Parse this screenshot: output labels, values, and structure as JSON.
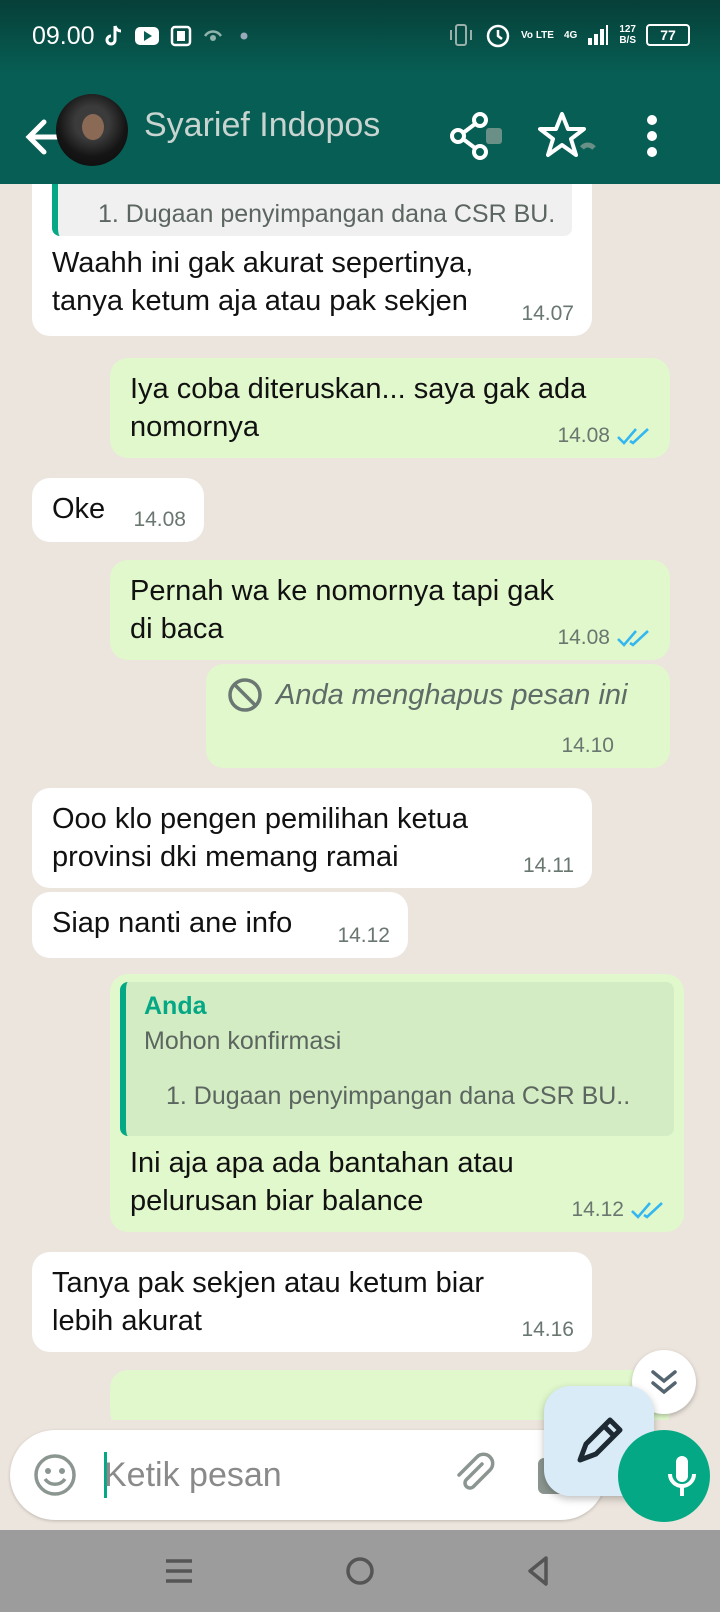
{
  "status_bar": {
    "time": "09.00",
    "net_type": "Vo LTE",
    "net_gen": "4G",
    "net_speed": "127",
    "net_speed_unit": "B/S",
    "battery": "77"
  },
  "header": {
    "contact_name": "Syarief Indopos"
  },
  "messages": [
    {
      "dir": "in",
      "quote_line": "1. Dugaan penyimpangan dana CSR BU..",
      "text": "Waahh ini gak akurat sepertinya, tanya ketum aja atau pak sekjen",
      "time": "14.07"
    },
    {
      "dir": "out",
      "text": "Iya coba diteruskan... saya gak ada nomornya",
      "time": "14.08"
    },
    {
      "dir": "in",
      "text": "Oke",
      "time": "14.08"
    },
    {
      "dir": "out",
      "text": "Pernah wa ke nomornya tapi gak di baca",
      "time": "14.08"
    },
    {
      "dir": "out",
      "deleted_text": "Anda menghapus pesan ini",
      "time": "14.10"
    },
    {
      "dir": "in",
      "text": "Ooo klo pengen pemilihan ketua provinsi dki memang ramai",
      "time": "14.11"
    },
    {
      "dir": "in",
      "text": "Siap nanti ane info",
      "time": "14.12"
    },
    {
      "dir": "out",
      "quote_author": "Anda",
      "quote_text": "Mohon konfirmasi",
      "quote_line": "1. Dugaan penyimpangan dana CSR BU..",
      "text": "Ini aja apa ada bantahan atau pelurusan biar balance",
      "time": "14.12"
    },
    {
      "dir": "in",
      "text": "Tanya pak sekjen atau ketum biar lebih akurat",
      "time": "14.16"
    }
  ],
  "composer": {
    "placeholder": "Ketik pesan"
  },
  "colors": {
    "header": "#075e54",
    "accent": "#05a884",
    "outgoing_bubble": "#e1f8cc",
    "incoming_bubble": "#ffffff",
    "read_ticks": "#34b7f1"
  },
  "icons": [
    "back-arrow-icon",
    "video-call-icon",
    "star-icon",
    "more-vert-icon",
    "double-check-icon",
    "blocked-icon",
    "chevron-double-down-icon",
    "pencil-icon",
    "emoji-icon",
    "paperclip-icon",
    "camera-icon",
    "mic-icon",
    "menu-nav-icon",
    "home-nav-icon",
    "back-nav-icon"
  ]
}
